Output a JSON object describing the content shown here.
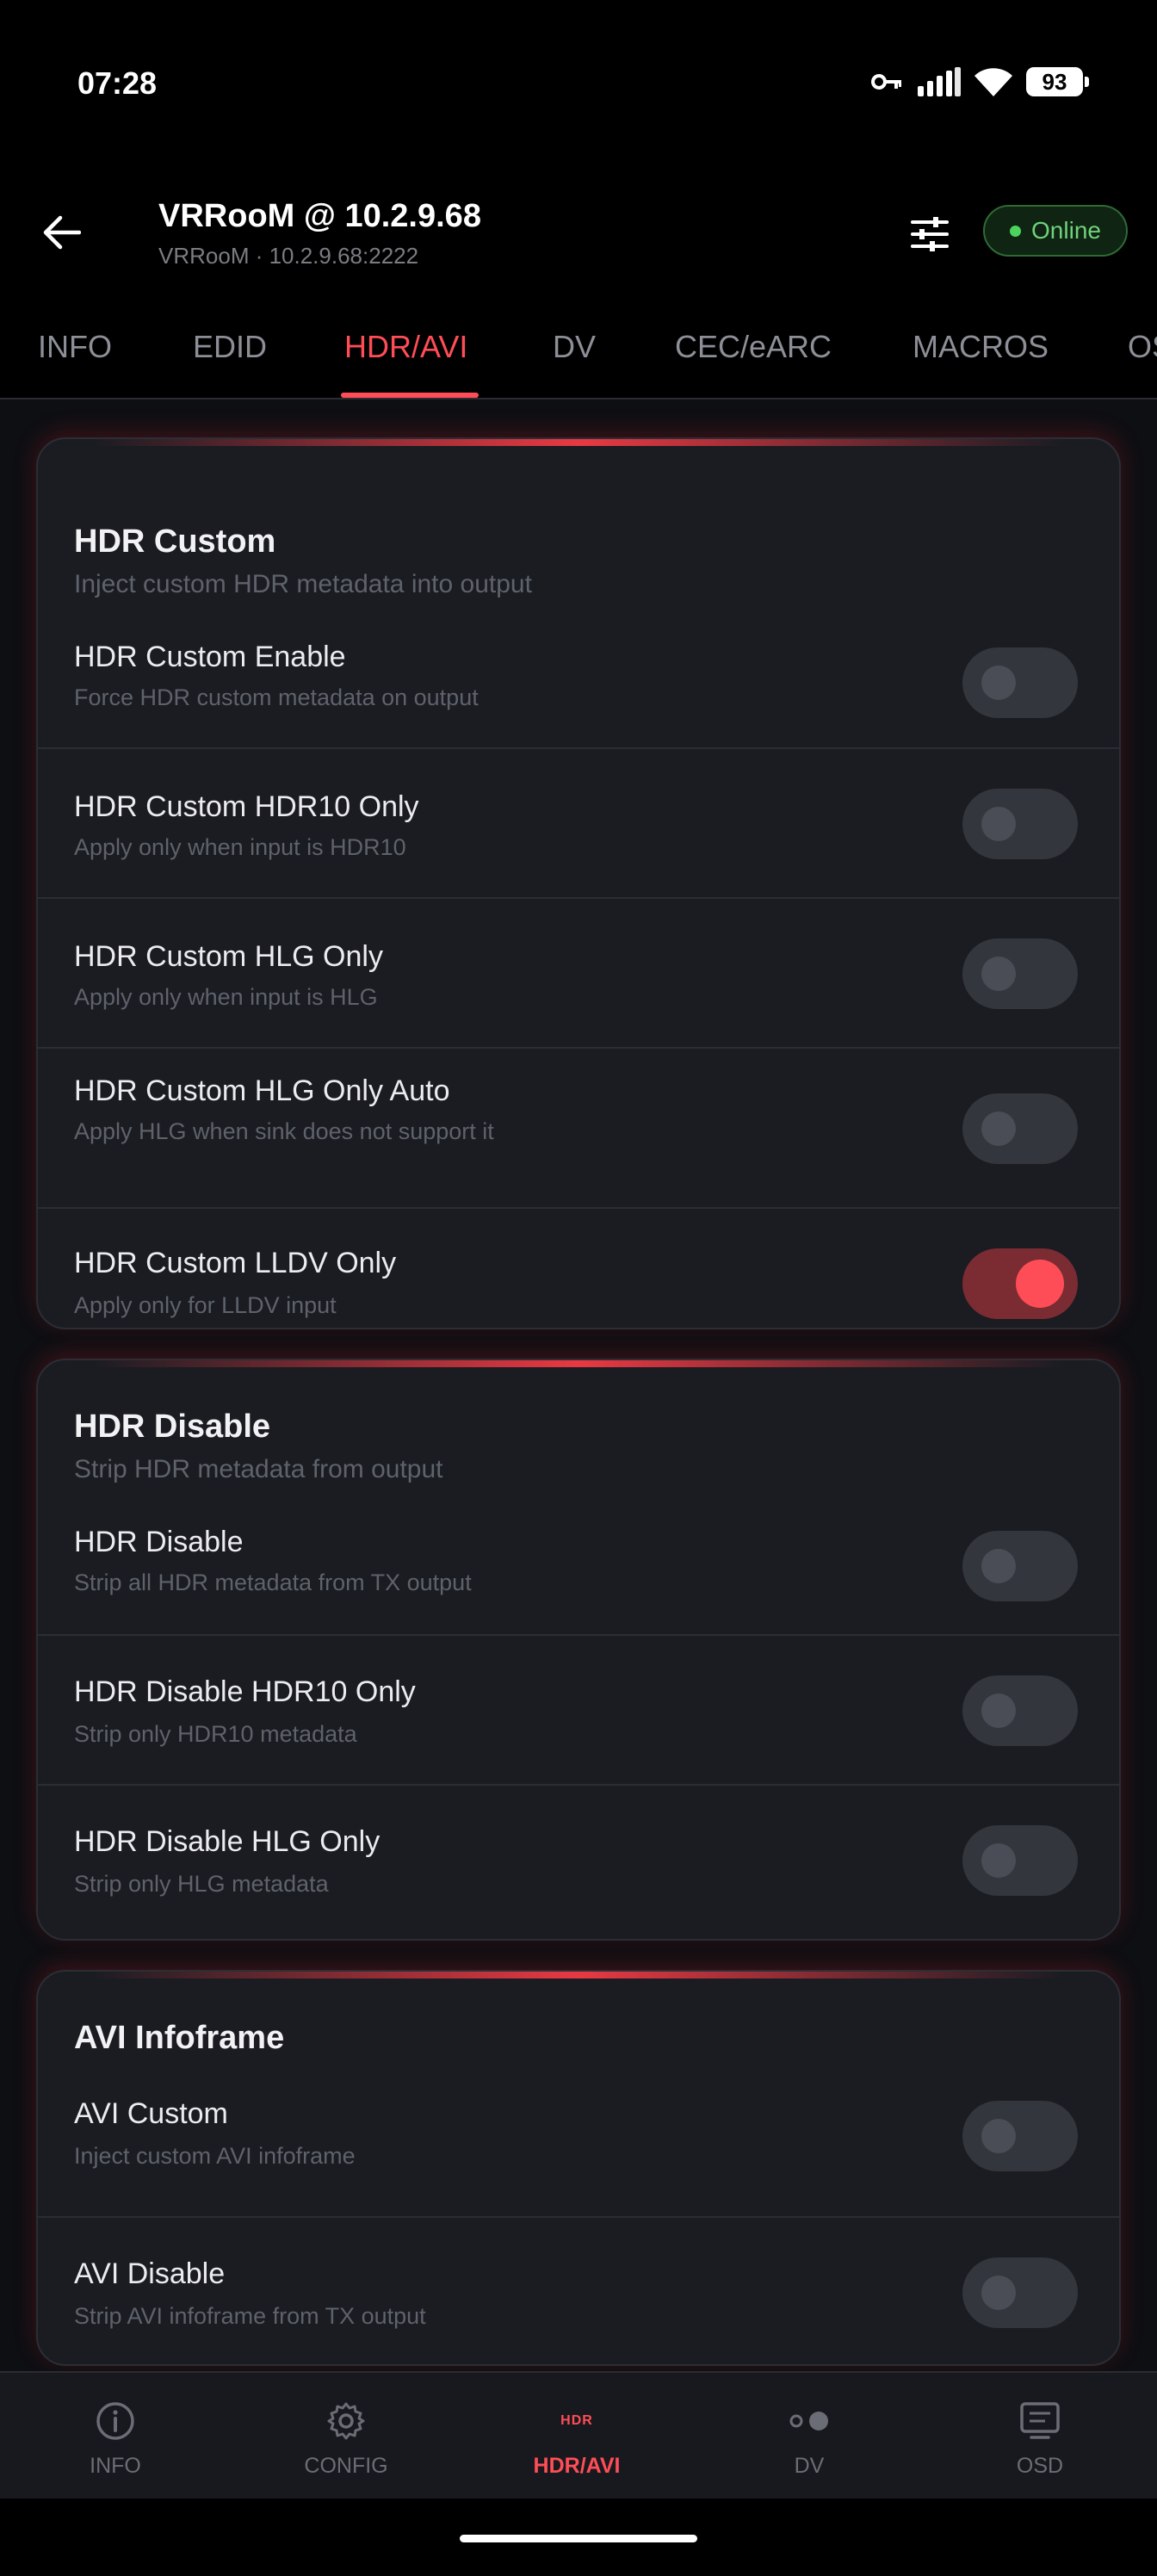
{
  "status": {
    "time": "07:28",
    "battery": "93"
  },
  "appbar": {
    "title": "VRRooM @ 10.2.9.68",
    "subtitle": "VRRooM · 10.2.9.68:2222",
    "status_label": "Online"
  },
  "tabs": [
    {
      "label": "INFO"
    },
    {
      "label": "EDID"
    },
    {
      "label": "HDR/AVI"
    },
    {
      "label": "DV"
    },
    {
      "label": "CEC/eARC"
    },
    {
      "label": "MACROS"
    },
    {
      "label": "OS"
    }
  ],
  "active_tab": "HDR/AVI",
  "sections": [
    {
      "title": "HDR Custom",
      "description": "Inject custom HDR metadata into output",
      "rows": [
        {
          "label": "HDR Custom Enable",
          "sub": "Force HDR custom metadata on output",
          "on": false
        },
        {
          "label": "HDR Custom HDR10 Only",
          "sub": "Apply only when input is HDR10",
          "on": false
        },
        {
          "label": "HDR Custom HLG Only",
          "sub": "Apply only when input is HLG",
          "on": false
        },
        {
          "label": "HDR Custom HLG Only Auto",
          "sub": "Apply HLG when sink does not support it",
          "on": false
        },
        {
          "label": "HDR Custom LLDV Only",
          "sub": "Apply only for LLDV input",
          "on": true
        }
      ]
    },
    {
      "title": "HDR Disable",
      "description": "Strip HDR metadata from output",
      "rows": [
        {
          "label": "HDR Disable",
          "sub": "Strip all HDR metadata from TX output",
          "on": false
        },
        {
          "label": "HDR Disable HDR10 Only",
          "sub": "Strip only HDR10 metadata",
          "on": false
        },
        {
          "label": "HDR Disable HLG Only",
          "sub": "Strip only HLG metadata",
          "on": false
        }
      ]
    },
    {
      "title": "AVI Infoframe",
      "rows": [
        {
          "label": "AVI Custom",
          "sub": "Inject custom AVI infoframe",
          "on": false
        },
        {
          "label": "AVI Disable",
          "sub": "Strip AVI infoframe from TX output",
          "on": false
        }
      ]
    }
  ],
  "bottom_nav": [
    {
      "label": "INFO",
      "icon": "info-icon"
    },
    {
      "label": "CONFIG",
      "icon": "gear-icon"
    },
    {
      "label": "HDR/AVI",
      "icon": "hdr-icon",
      "glyph": "HDR"
    },
    {
      "label": "DV",
      "icon": "dv-toggle-icon"
    },
    {
      "label": "OSD",
      "icon": "osd-screen-icon"
    }
  ],
  "colors": {
    "accent": "#ff4d57",
    "online": "#4cd35e",
    "card": "#1a1c22",
    "background": "#0e0f13"
  }
}
